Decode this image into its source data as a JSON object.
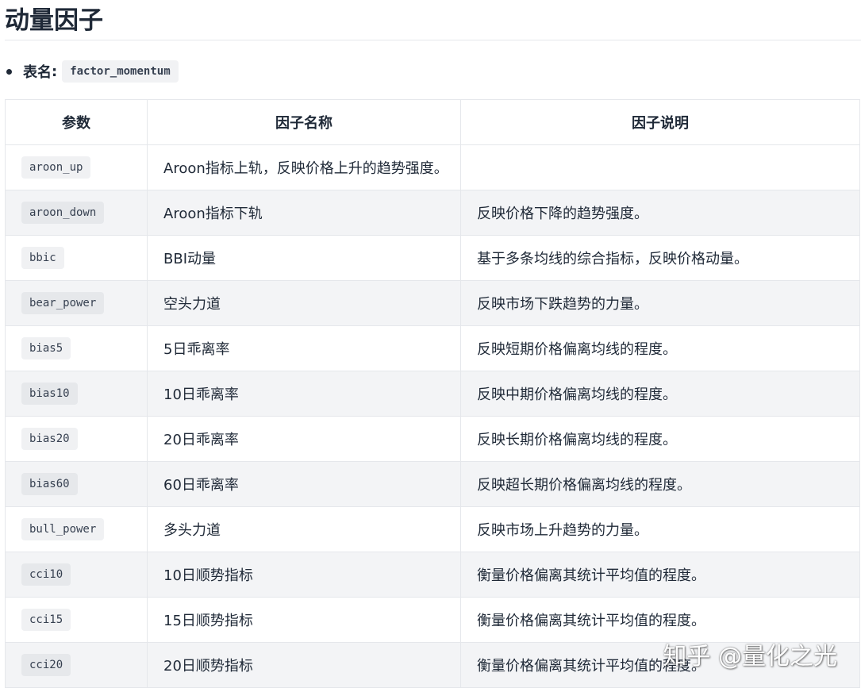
{
  "document": {
    "title": "动量因子",
    "table_meta": {
      "label": "表名",
      "separator": ":",
      "value": "factor_momentum"
    }
  },
  "table": {
    "headers": [
      "参数",
      "因子名称",
      "因子说明"
    ],
    "rows": [
      {
        "param": "aroon_up",
        "name": "Aroon指标上轨，反映价格上升的趋势强度。",
        "desc": ""
      },
      {
        "param": "aroon_down",
        "name": "Aroon指标下轨",
        "desc": "反映价格下降的趋势强度。"
      },
      {
        "param": "bbic",
        "name": "BBI动量",
        "desc": "基于多条均线的综合指标，反映价格动量。"
      },
      {
        "param": "bear_power",
        "name": "空头力道",
        "desc": "反映市场下跌趋势的力量。"
      },
      {
        "param": "bias5",
        "name": "5日乖离率",
        "desc": "反映短期价格偏离均线的程度。"
      },
      {
        "param": "bias10",
        "name": "10日乖离率",
        "desc": "反映中期价格偏离均线的程度。"
      },
      {
        "param": "bias20",
        "name": "20日乖离率",
        "desc": "反映长期价格偏离均线的程度。"
      },
      {
        "param": "bias60",
        "name": "60日乖离率",
        "desc": "反映超长期价格偏离均线的程度。"
      },
      {
        "param": "bull_power",
        "name": "多头力道",
        "desc": "反映市场上升趋势的力量。"
      },
      {
        "param": "cci10",
        "name": "10日顺势指标",
        "desc": "衡量价格偏离其统计平均值的程度。"
      },
      {
        "param": "cci15",
        "name": "15日顺势指标",
        "desc": "衡量价格偏离其统计平均值的程度。"
      },
      {
        "param": "cci20",
        "name": "20日顺势指标",
        "desc": "衡量价格偏离其统计平均值的程度。"
      }
    ]
  },
  "watermark": {
    "text": "知乎 @量化之光"
  }
}
